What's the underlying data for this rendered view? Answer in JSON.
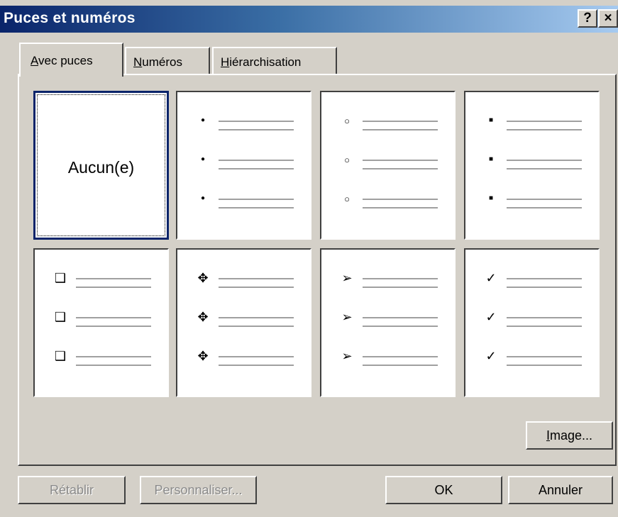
{
  "window": {
    "title": "Puces et numéros",
    "help_label": "?",
    "close_label": "×"
  },
  "tabs": [
    {
      "access_key": "A",
      "rest": "vec puces"
    },
    {
      "access_key": "N",
      "rest": "uméros"
    },
    {
      "access_key": "H",
      "rest": "iérarchisation"
    }
  ],
  "gallery": {
    "none_label": "Aucun(e)",
    "styles": [
      {
        "name": "aucun",
        "glyph": ""
      },
      {
        "name": "puce-ronde",
        "glyph": "●"
      },
      {
        "name": "puce-cercle",
        "glyph": "○"
      },
      {
        "name": "puce-carree",
        "glyph": "■"
      },
      {
        "name": "puce-case",
        "glyph": "❑"
      },
      {
        "name": "puce-losanges",
        "glyph": "✥"
      },
      {
        "name": "puce-fleche",
        "glyph": "➢"
      },
      {
        "name": "puce-coche",
        "glyph": "✓"
      }
    ]
  },
  "buttons": {
    "image": {
      "access_key": "I",
      "rest": "mage..."
    },
    "reset": "Rétablir",
    "customize": "Personnaliser...",
    "ok": "OK",
    "cancel": "Annuler"
  }
}
